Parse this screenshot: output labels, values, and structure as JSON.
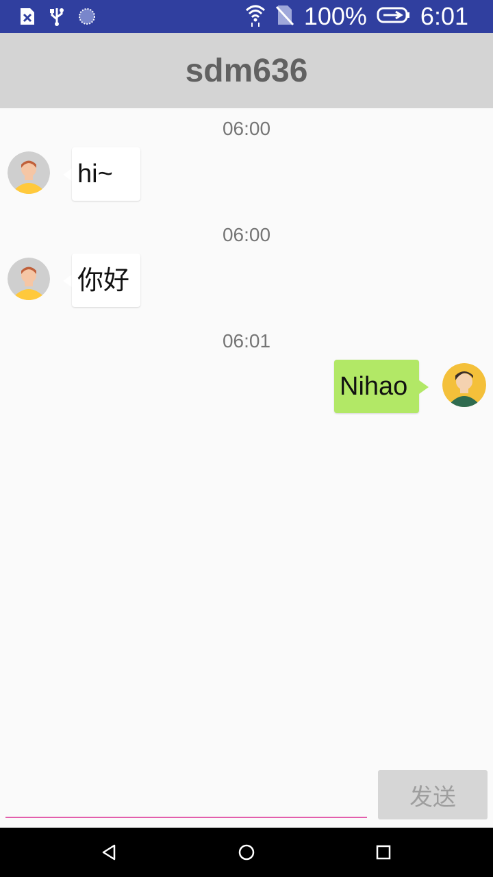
{
  "status_bar": {
    "battery_percent": "100%",
    "time": "6:01",
    "icons": [
      "sim-error-icon",
      "usb-icon",
      "sync-icon",
      "wifi-icon",
      "no-sim-icon",
      "battery-charging-icon"
    ]
  },
  "app_bar": {
    "title": "sdm636"
  },
  "messages": [
    {
      "time": "06:00",
      "text": "hi~",
      "side": "left"
    },
    {
      "time": "06:00",
      "text": "你好",
      "side": "left"
    },
    {
      "time": "06:01",
      "text": "Nihao",
      "side": "right"
    }
  ],
  "composer": {
    "input_value": "",
    "send_label": "发送"
  },
  "nav_bar": {
    "icons": [
      "back-icon",
      "home-icon",
      "recents-icon"
    ]
  },
  "colors": {
    "status_bar": "#303f9f",
    "app_bar": "#d4d4d4",
    "sent_bubble": "#b2e866",
    "accent_line": "#d81b8a"
  }
}
